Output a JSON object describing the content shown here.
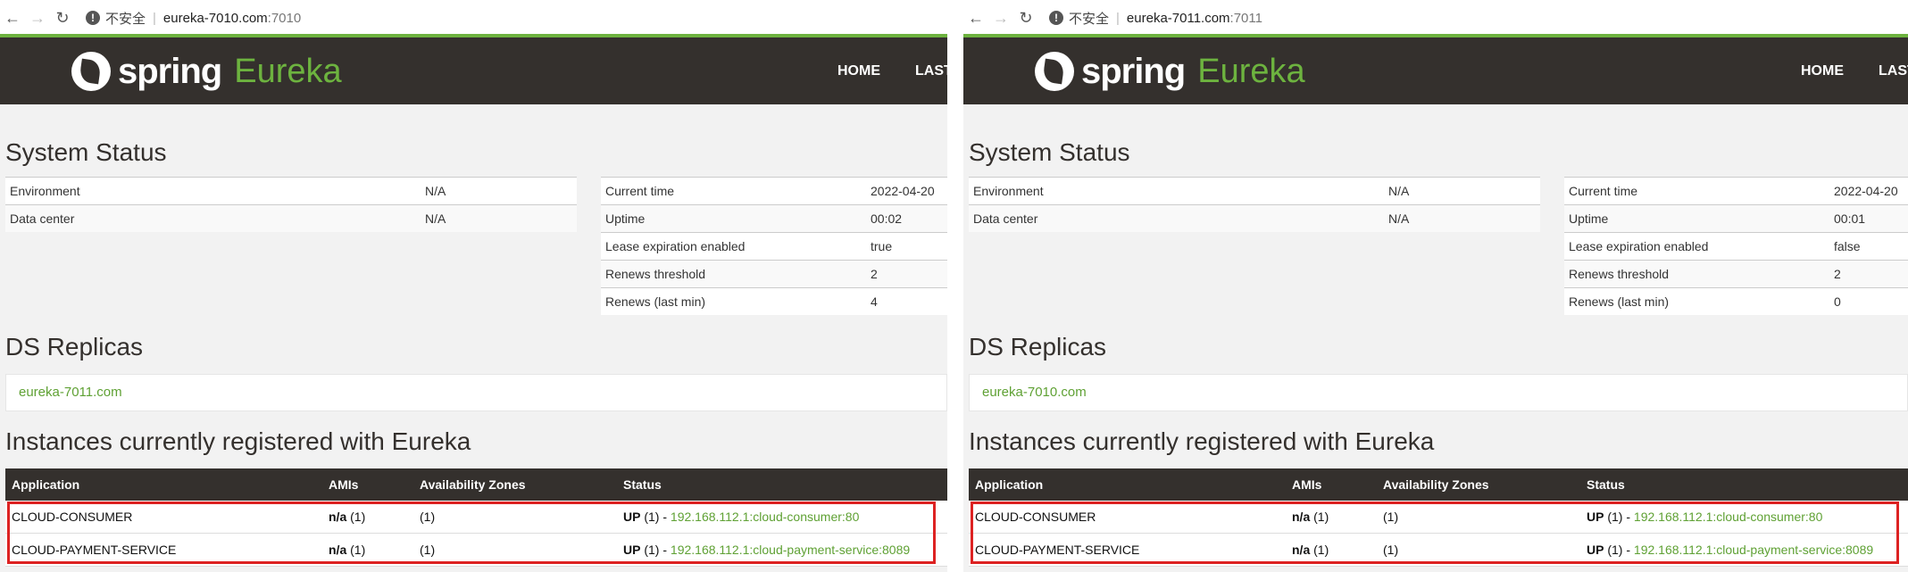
{
  "panels": [
    {
      "address_bar": {
        "security": "不安全",
        "host": "eureka-7010.com",
        "port": ":7010"
      },
      "brand": {
        "spring": "spring",
        "product": "Eureka"
      },
      "nav": {
        "home": "HOME",
        "last": "LAST"
      },
      "system_status": {
        "title": "System Status",
        "left": [
          {
            "label": "Environment",
            "value": "N/A"
          },
          {
            "label": "Data center",
            "value": "N/A"
          }
        ],
        "right": [
          {
            "label": "Current time",
            "value": "2022-04-20"
          },
          {
            "label": "Uptime",
            "value": "00:02"
          },
          {
            "label": "Lease expiration enabled",
            "value": "true"
          },
          {
            "label": "Renews threshold",
            "value": "2"
          },
          {
            "label": "Renews (last min)",
            "value": "4"
          }
        ]
      },
      "ds_replicas": {
        "title": "DS Replicas",
        "replica": "eureka-7011.com"
      },
      "instances": {
        "title": "Instances currently registered with Eureka",
        "headers": [
          "Application",
          "AMIs",
          "Availability Zones",
          "Status"
        ],
        "rows": [
          {
            "app": "CLOUD-CONSUMER",
            "amis_bold": "n/a",
            "amis_count": "(1)",
            "zones": "(1)",
            "status_bold": "UP",
            "status_rest": "(1) -",
            "instance": "192.168.112.1:cloud-consumer:80"
          },
          {
            "app": "CLOUD-PAYMENT-SERVICE",
            "amis_bold": "n/a",
            "amis_count": "(1)",
            "zones": "(1)",
            "status_bold": "UP",
            "status_rest": "(1) -",
            "instance": "192.168.112.1:cloud-payment-service:8089"
          }
        ]
      }
    },
    {
      "address_bar": {
        "security": "不安全",
        "host": "eureka-7011.com",
        "port": ":7011"
      },
      "brand": {
        "spring": "spring",
        "product": "Eureka"
      },
      "nav": {
        "home": "HOME",
        "last": "LAST"
      },
      "system_status": {
        "title": "System Status",
        "left": [
          {
            "label": "Environment",
            "value": "N/A"
          },
          {
            "label": "Data center",
            "value": "N/A"
          }
        ],
        "right": [
          {
            "label": "Current time",
            "value": "2022-04-20"
          },
          {
            "label": "Uptime",
            "value": "00:01"
          },
          {
            "label": "Lease expiration enabled",
            "value": "false"
          },
          {
            "label": "Renews threshold",
            "value": "2"
          },
          {
            "label": "Renews (last min)",
            "value": "0"
          }
        ]
      },
      "ds_replicas": {
        "title": "DS Replicas",
        "replica": "eureka-7010.com"
      },
      "instances": {
        "title": "Instances currently registered with Eureka",
        "headers": [
          "Application",
          "AMIs",
          "Availability Zones",
          "Status"
        ],
        "rows": [
          {
            "app": "CLOUD-CONSUMER",
            "amis_bold": "n/a",
            "amis_count": "(1)",
            "zones": "(1)",
            "status_bold": "UP",
            "status_rest": "(1) -",
            "instance": "192.168.112.1:cloud-consumer:80"
          },
          {
            "app": "CLOUD-PAYMENT-SERVICE",
            "amis_bold": "n/a",
            "amis_count": "(1)",
            "zones": "(1)",
            "status_bold": "UP",
            "status_rest": "(1) -",
            "instance": "192.168.112.1:cloud-payment-service:8089"
          }
        ]
      }
    }
  ],
  "colors": {
    "navbar": "#34302d",
    "spring_green": "#6db33f",
    "link_green": "#5fa134",
    "highlight": "#dd2222"
  }
}
